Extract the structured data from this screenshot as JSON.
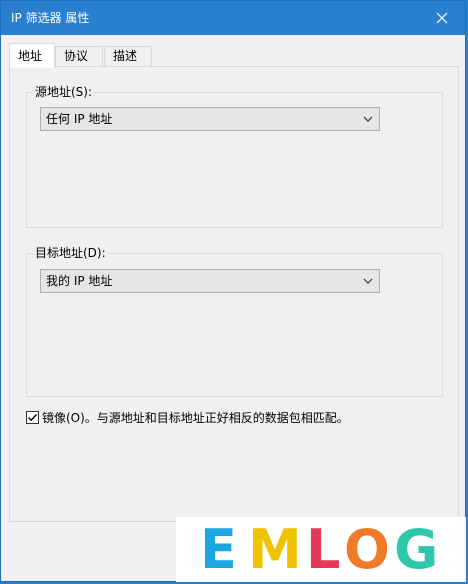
{
  "window": {
    "title": "IP 筛选器 属性",
    "close_icon": "close-icon"
  },
  "tabs": [
    {
      "label": "地址",
      "selected": true
    },
    {
      "label": "协议",
      "selected": false
    },
    {
      "label": "描述",
      "selected": false
    }
  ],
  "source": {
    "label": "源地址(S):",
    "value": "任何 IP 地址"
  },
  "destination": {
    "label": "目标地址(D):",
    "value": "我的 IP 地址"
  },
  "mirror": {
    "checked": true,
    "label": "镜像(O)。与源地址和目标地址正好相反的数据包相匹配。"
  },
  "watermark": {
    "text": "EMLOG",
    "letters": [
      "E",
      "M",
      "L",
      "O",
      "G"
    ],
    "colors": [
      "#1ea6e3",
      "#f0c300",
      "#e43a57",
      "#f07a27",
      "#2fc7a9"
    ]
  },
  "colors": {
    "titlebar": "#2b7fd0",
    "dialog_bg": "#f0f0f0"
  }
}
